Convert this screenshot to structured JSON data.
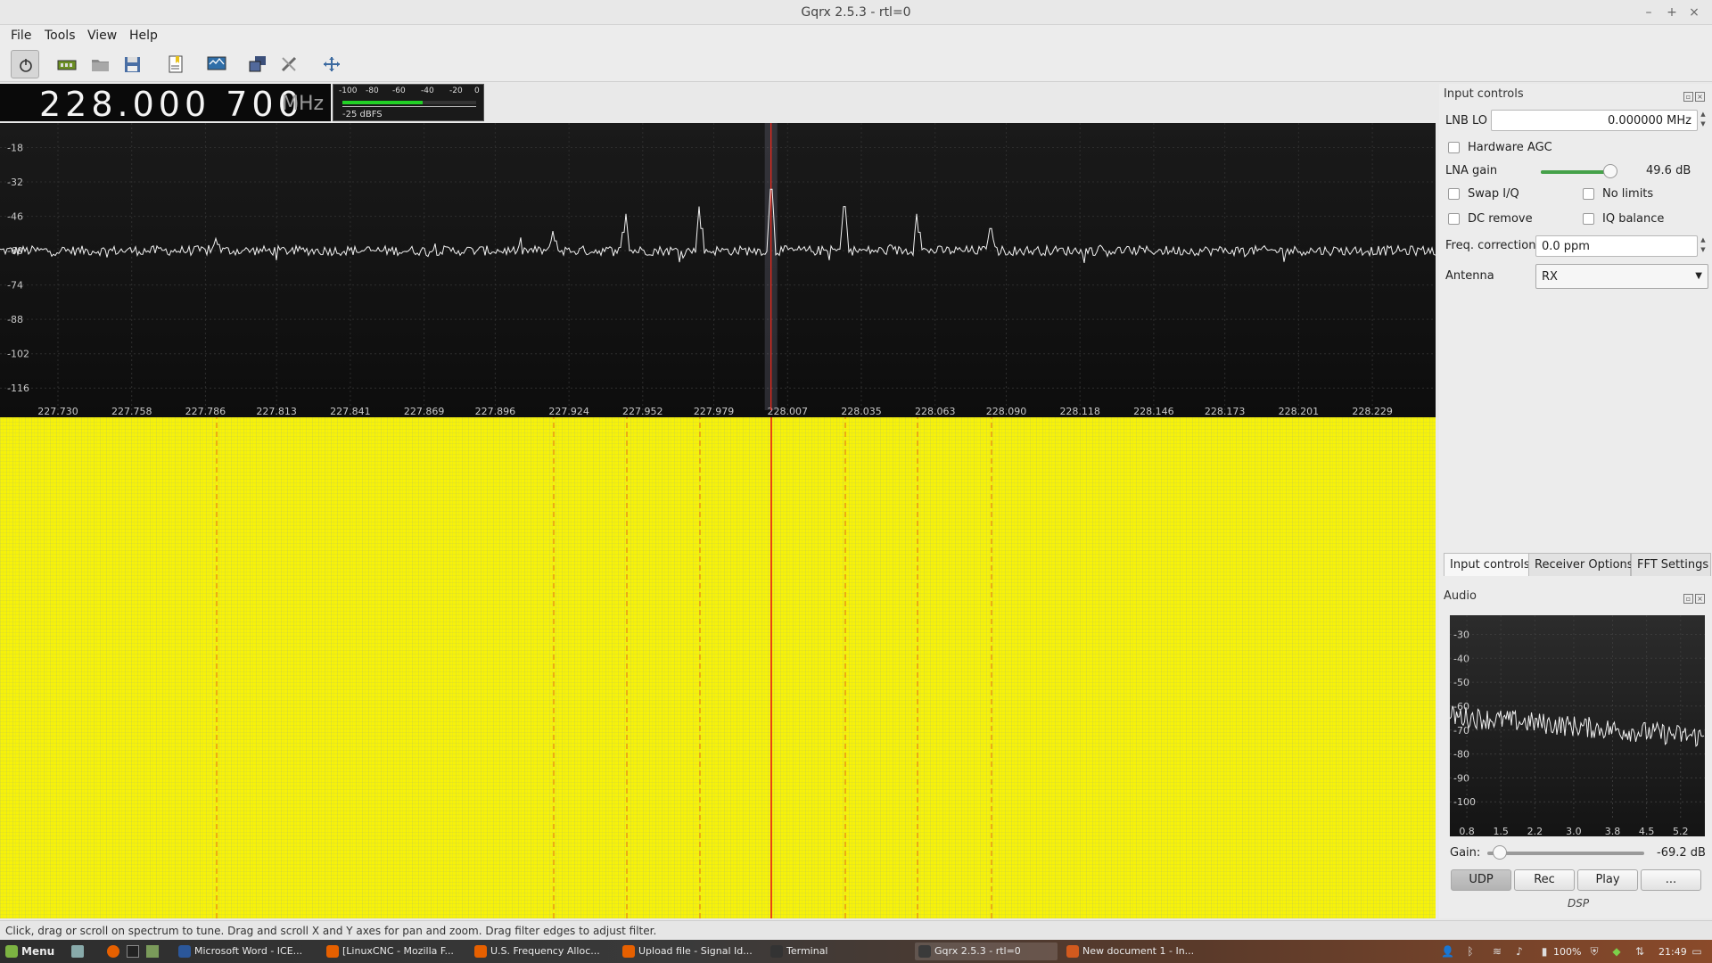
{
  "window": {
    "title": "Gqrx 2.5.3 - rtl=0"
  },
  "menu": [
    "File",
    "Tools",
    "View",
    "Help"
  ],
  "frequency": {
    "digits": "228.000 700",
    "unit": "MHz"
  },
  "smeter": {
    "scale": [
      "-100",
      "-80",
      "-60",
      "-40",
      "-20",
      "0"
    ],
    "level_text": "-25 dBFS",
    "fill_fraction": 0.6
  },
  "spectrum": {
    "y_ticks": [
      "-18",
      "-32",
      "-46",
      "-60",
      "-74",
      "-88",
      "-102",
      "-116"
    ],
    "x_ticks": [
      "227.730",
      "227.758",
      "227.786",
      "227.813",
      "227.841",
      "227.869",
      "227.896",
      "227.924",
      "227.952",
      "227.979",
      "228.007",
      "228.035",
      "228.063",
      "228.090",
      "228.118",
      "228.146",
      "228.173",
      "228.201",
      "228.229"
    ],
    "x_range_mhz": [
      227.708,
      228.253
    ],
    "noise_floor_db": -60,
    "y_range_db": [
      -125,
      -8
    ],
    "center_mhz": 228.0007,
    "peaks": [
      {
        "mhz": 227.9455,
        "db": -45
      },
      {
        "mhz": 227.9735,
        "db": -42
      },
      {
        "mhz": 228.0007,
        "db": -35
      },
      {
        "mhz": 228.0285,
        "db": -42
      },
      {
        "mhz": 228.056,
        "db": -45
      },
      {
        "mhz": 228.084,
        "db": -51
      },
      {
        "mhz": 227.918,
        "db": -52
      },
      {
        "mhz": 227.79,
        "db": -55
      }
    ]
  },
  "input_controls": {
    "title": "Input controls",
    "lnb_lo_label": "LNB LO",
    "lnb_lo_value": "0.000000 MHz",
    "hardware_agc": "Hardware AGC",
    "lna_gain_label": "LNA gain",
    "lna_gain_value": "49.6 dB",
    "lna_gain_fraction": 0.95,
    "swap_iq": "Swap I/Q",
    "no_limits": "No limits",
    "dc_remove": "DC remove",
    "iq_balance": "IQ balance",
    "freq_corr_label": "Freq. correction",
    "freq_corr_value": "0.0 ppm",
    "antenna_label": "Antenna",
    "antenna_value": "RX"
  },
  "tabs": [
    "Input controls",
    "Receiver Options",
    "FFT Settings"
  ],
  "audio": {
    "title": "Audio",
    "y_ticks": [
      "-30",
      "-40",
      "-50",
      "-60",
      "-70",
      "-80",
      "-90",
      "-100"
    ],
    "x_ticks": [
      "0.8",
      "1.5",
      "2.2",
      "3.0",
      "3.8",
      "4.5",
      "5.2"
    ],
    "gain_label": "Gain:",
    "gain_value": "-69.2 dB",
    "gain_fraction": 0.08,
    "buttons": [
      "UDP",
      "Rec",
      "Play",
      "..."
    ],
    "dsp_label": "DSP"
  },
  "status": {
    "message": "Click, drag or scroll on spectrum to tune. Drag and scroll X and Y axes for pan and zoom. Drag filter edges to adjust filter."
  },
  "taskbar": {
    "menu_label": "Menu",
    "items": [
      {
        "label": "Microsoft Word - ICE...",
        "color": "#2b579a"
      },
      {
        "label": "[LinuxCNC - Mozilla F...",
        "color": "#e66000"
      },
      {
        "label": "U.S. Frequency Alloc...",
        "color": "#e66000"
      },
      {
        "label": "Upload file - Signal Id...",
        "color": "#e66000"
      },
      {
        "label": "Terminal",
        "color": "#333333"
      },
      {
        "label": "Gqrx 2.5.3 - rtl=0",
        "color": "#3a3a3a"
      },
      {
        "label": "New document 1 - In...",
        "color": "#d25a1e"
      }
    ],
    "battery": "100%",
    "clock": "21:49"
  },
  "colors": {
    "accent_green": "#45a149",
    "waterfall_yellow": "#f7f20a",
    "signal_red": "#ff2a1a"
  }
}
